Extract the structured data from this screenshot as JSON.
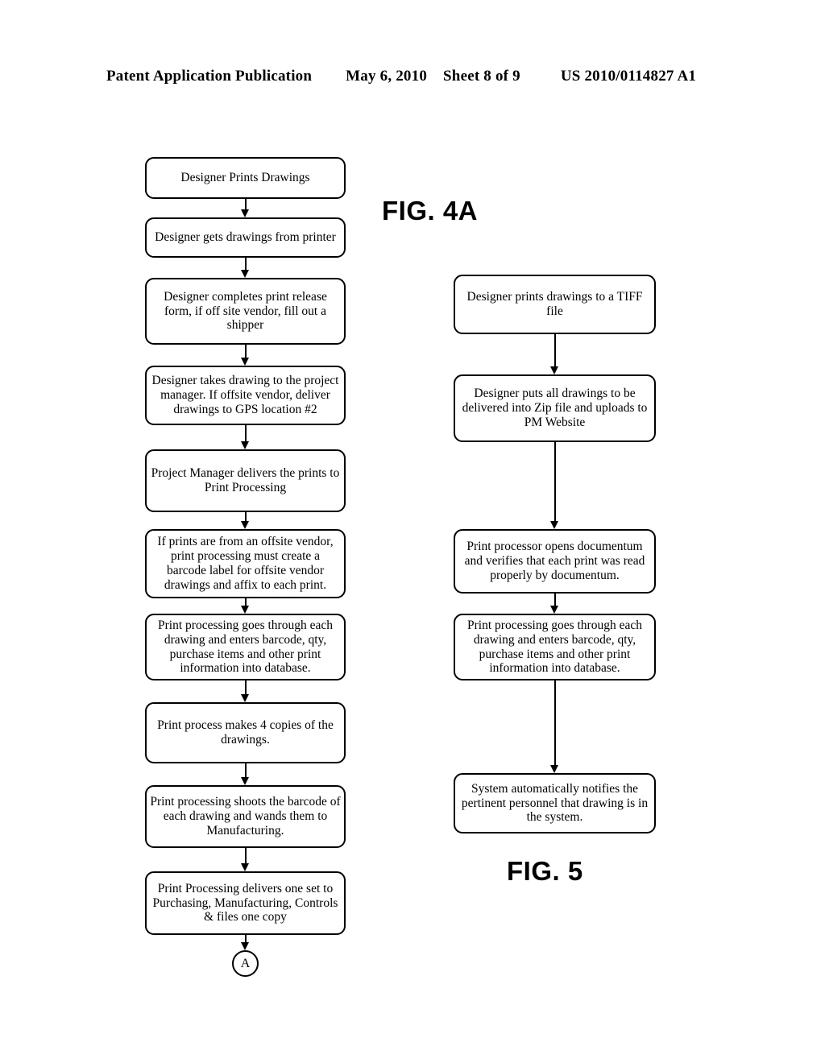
{
  "header": {
    "publication": "Patent Application Publication",
    "date": "May 6, 2010",
    "sheet": "Sheet 8 of 9",
    "patent_number": "US 2010/0114827 A1"
  },
  "figures": [
    {
      "id": "fig-4a",
      "label": "FIG. 4A"
    },
    {
      "id": "fig-5",
      "label": "FIG. 5"
    }
  ],
  "flowchart_left": {
    "figure": "FIG. 4A",
    "nodes": [
      {
        "id": "l1",
        "type": "process",
        "text": "Designer Prints Drawings"
      },
      {
        "id": "l2",
        "type": "process",
        "text": "Designer gets drawings from printer"
      },
      {
        "id": "l3",
        "type": "process",
        "text": "Designer completes print release form, if off site vendor, fill out a shipper"
      },
      {
        "id": "l4",
        "type": "process",
        "text": "Designer takes drawing to the project manager. If offsite vendor, deliver drawings to GPS location #2"
      },
      {
        "id": "l5",
        "type": "process",
        "text": "Project Manager delivers the prints to Print Processing"
      },
      {
        "id": "l6",
        "type": "process",
        "text": "If prints are from an offsite vendor, print processing must create a barcode label for offsite vendor drawings and affix to each print."
      },
      {
        "id": "l7",
        "type": "process",
        "text": "Print processing goes through each drawing and enters barcode, qty, purchase items and other print information into database."
      },
      {
        "id": "l8",
        "type": "process",
        "text": "Print process makes 4 copies of the drawings."
      },
      {
        "id": "l9",
        "type": "process",
        "text": "Print processing shoots the barcode of each drawing and wands them to Manufacturing."
      },
      {
        "id": "l10",
        "type": "process",
        "text": "Print Processing delivers one set to Purchasing, Manufacturing, Controls & files one copy"
      },
      {
        "id": "l11",
        "type": "connector",
        "text": "A"
      }
    ]
  },
  "flowchart_right": {
    "figure": "FIG. 5",
    "nodes": [
      {
        "id": "r1",
        "type": "process",
        "text": "Designer prints drawings to a TIFF file"
      },
      {
        "id": "r2",
        "type": "process",
        "text": "Designer puts all drawings to be delivered into Zip file and uploads to PM Website"
      },
      {
        "id": "r3",
        "type": "process",
        "text": "Print processor opens documentum and verifies that each print was read properly by documentum."
      },
      {
        "id": "r4",
        "type": "process",
        "text": "Print processing goes through each drawing and enters barcode, qty, purchase items and other print information into database."
      },
      {
        "id": "r5",
        "type": "process",
        "text": "System automatically notifies the pertinent personnel that drawing is in the system."
      }
    ]
  },
  "colors": {
    "ink": "#000000",
    "page": "#ffffff"
  }
}
